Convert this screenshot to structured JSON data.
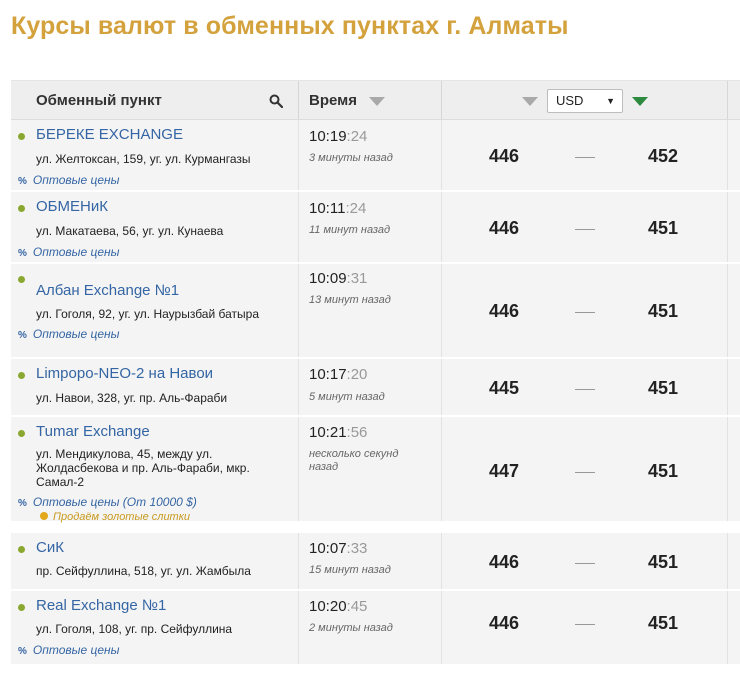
{
  "title": "Курсы валют в обменных пунктах г. Алматы",
  "header": {
    "point_label": "Обменный пункт",
    "time_label": "Время",
    "currency": "USD"
  },
  "rows": [
    {
      "name": "БЕРЕКЕ EXCHANGE",
      "address": "ул. Желтоксан, 159, уг. ул. Курмангазы",
      "time": "10:19",
      "sec": ":24",
      "ago": "3 минуты назад",
      "buy": "446",
      "sell": "452",
      "wholesale": "Оптовые цены"
    },
    {
      "name": "ОБМЕНиК",
      "address": "ул. Макатаева, 56, уг. ул. Кунаева",
      "time": "10:11",
      "sec": ":24",
      "ago": "11 минут назад",
      "buy": "446",
      "sell": "451",
      "wholesale": "Оптовые цены"
    },
    {
      "name": "Албан Exchange №1",
      "address": "ул. Гоголя, 92, уг. ул. Наурызбай батыра",
      "time": "10:09",
      "sec": ":31",
      "ago": "13 минут назад",
      "buy": "446",
      "sell": "451",
      "wholesale": "Оптовые цены"
    },
    {
      "name": "Limpopo-NEO-2 на Навои",
      "address": "ул. Навои, 328, уг. пр. Аль-Фараби",
      "time": "10:17",
      "sec": ":20",
      "ago": "5 минут назад",
      "buy": "445",
      "sell": "451"
    },
    {
      "name": "Tumar Exchange",
      "address": "ул. Мендикулова, 45, между ул. Жолдасбекова и пр. Аль-Фараби, мкр. Самал-2",
      "time": "10:21",
      "sec": ":56",
      "ago": "несколько секунд назад",
      "buy": "447",
      "sell": "451",
      "wholesale": "Оптовые цены (От 10000 $)",
      "gold": "Продаём золотые слитки"
    },
    {
      "name": "СиК",
      "address": "пр. Сейфуллина, 518, уг. ул. Жамбыла",
      "time": "10:07",
      "sec": ":33",
      "ago": "15 минут назад",
      "buy": "446",
      "sell": "451"
    },
    {
      "name": "Real Exchange №1",
      "address": "ул. Гоголя, 108, уг. пр. Сейфуллина",
      "time": "10:20",
      "sec": ":45",
      "ago": "2 минуты назад",
      "buy": "446",
      "sell": "451",
      "wholesale": "Оптовые цены"
    }
  ],
  "colors": {
    "title": "#d4a23d",
    "link": "#3465a4",
    "status_dot": "#8aa82f",
    "sort_active": "#2b8a3e",
    "gold": "#e0a81a"
  },
  "icons": {
    "search": "search-icon",
    "sort": "sort-arrow-icon",
    "percent": "percent-icon",
    "status": "status-dot-icon",
    "gold": "gold-dot-icon"
  }
}
